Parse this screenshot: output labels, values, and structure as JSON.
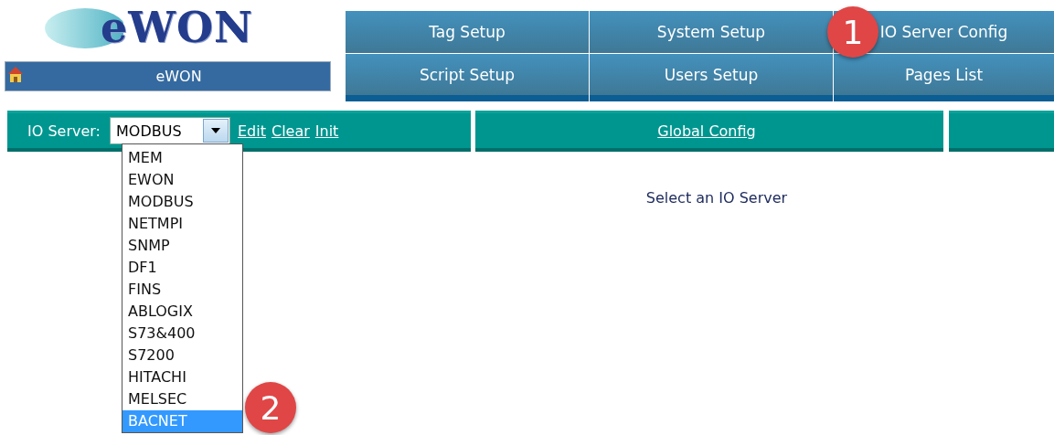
{
  "logo": {
    "text": "eWON"
  },
  "title_bar": {
    "text": "eWON"
  },
  "menu": [
    {
      "label": "Tag Setup"
    },
    {
      "label": "System Setup"
    },
    {
      "label": "IO Server Config"
    },
    {
      "label": "Script Setup"
    },
    {
      "label": "Users Setup"
    },
    {
      "label": "Pages List"
    }
  ],
  "toolbar": {
    "label": "IO Server:",
    "select_value": "MODBUS",
    "links": [
      "Edit",
      "Clear",
      "Init"
    ],
    "global_link": "Global Config"
  },
  "dropdown": [
    {
      "label": "MEM",
      "selected": false
    },
    {
      "label": "EWON",
      "selected": false
    },
    {
      "label": "MODBUS",
      "selected": false
    },
    {
      "label": "NETMPI",
      "selected": false
    },
    {
      "label": "SNMP",
      "selected": false
    },
    {
      "label": "DF1",
      "selected": false
    },
    {
      "label": "FINS",
      "selected": false
    },
    {
      "label": "ABLOGIX",
      "selected": false
    },
    {
      "label": "S73&400",
      "selected": false
    },
    {
      "label": "S7200",
      "selected": false
    },
    {
      "label": "HITACHI",
      "selected": false
    },
    {
      "label": "MELSEC",
      "selected": false
    },
    {
      "label": "BACNET",
      "selected": true
    }
  ],
  "message": "Select an IO Server",
  "callouts": [
    "1",
    "2"
  ]
}
